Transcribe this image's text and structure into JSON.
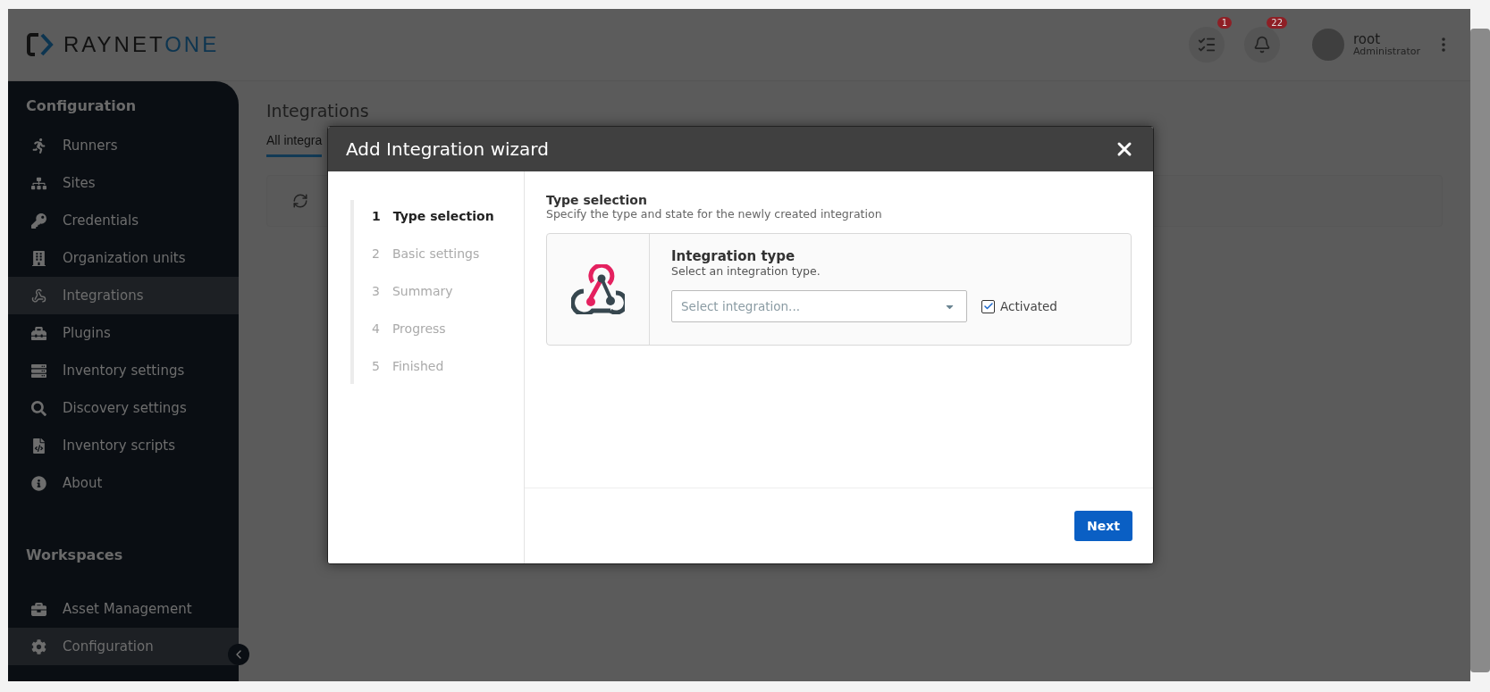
{
  "header": {
    "logo": {
      "name": "RAYNET",
      "suffix": "ONE"
    },
    "tasks_badge": "1",
    "notifications_badge": "22",
    "user": {
      "name": "root",
      "role": "Administrator"
    }
  },
  "sidebar": {
    "sections": [
      {
        "title": "Configuration",
        "items": [
          {
            "label": "Runners",
            "selected": false
          },
          {
            "label": "Sites",
            "selected": false
          },
          {
            "label": "Credentials",
            "selected": false
          },
          {
            "label": "Organization units",
            "selected": false
          },
          {
            "label": "Integrations",
            "selected": true
          },
          {
            "label": "Plugins",
            "selected": false
          },
          {
            "label": "Inventory settings",
            "selected": false
          },
          {
            "label": "Discovery settings",
            "selected": false
          },
          {
            "label": "Inventory scripts",
            "selected": false
          },
          {
            "label": "About",
            "selected": false
          }
        ]
      },
      {
        "title": "Workspaces",
        "items": [
          {
            "label": "Asset Management",
            "selected": false
          },
          {
            "label": "Configuration",
            "selected": true
          }
        ]
      }
    ]
  },
  "page": {
    "title": "Integrations",
    "tabs": [
      {
        "label": "All integra",
        "selected": true
      }
    ]
  },
  "modal": {
    "title": "Add Integration wizard",
    "steps": [
      {
        "number": "1",
        "label": "Type selection",
        "selected": true
      },
      {
        "number": "2",
        "label": "Basic settings",
        "selected": false
      },
      {
        "number": "3",
        "label": "Summary",
        "selected": false
      },
      {
        "number": "4",
        "label": "Progress",
        "selected": false
      },
      {
        "number": "5",
        "label": "Finished",
        "selected": false
      }
    ],
    "section_title": "Type selection",
    "section_subtitle": "Specify the type and state for the newly created integration",
    "integration": {
      "title": "Integration type",
      "hint": "Select an integration type.",
      "select": {
        "placeholder": "Select integration..."
      },
      "activated": {
        "label": "Activated",
        "checked": true
      }
    },
    "buttons": [
      {
        "label": "Next"
      }
    ]
  }
}
